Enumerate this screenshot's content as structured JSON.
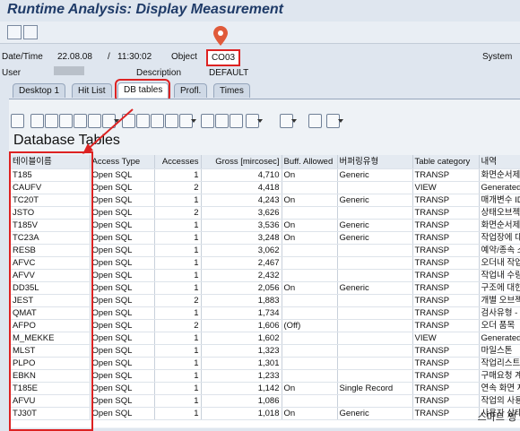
{
  "title": "Runtime Analysis: Display Measurement",
  "info": {
    "date_label": "Date/Time",
    "date": "22.08.08",
    "sep": "/",
    "time": "11:30:02",
    "object_label": "Object",
    "object_value": "CO03",
    "system_label": "System",
    "user_label": "User",
    "description_label": "Description",
    "description_value": "DEFAULT"
  },
  "tabs": [
    "Desktop 1",
    "Hit List",
    "DB tables",
    "Profl.",
    "Times"
  ],
  "heading": "Database Tables",
  "columns": [
    "테이블이름",
    "Access Type",
    "Accesses",
    "Gross [mircosec]",
    "Buff. Allowed",
    "버퍼링유형",
    "Table category",
    "내역"
  ],
  "rows": [
    [
      "T185",
      "Open SQL",
      "1",
      "4,710",
      "On",
      "Generic",
      "TRANSP",
      "화면순서제어"
    ],
    [
      "CAUFV",
      "Open SQL",
      "2",
      "4,418",
      "",
      "",
      "VIEW",
      "Generated T"
    ],
    [
      "TC20T",
      "Open SQL",
      "1",
      "4,243",
      "On",
      "Generic",
      "TRANSP",
      "매개변수 ID"
    ],
    [
      "JSTO",
      "Open SQL",
      "2",
      "3,626",
      "",
      "",
      "TRANSP",
      "상태오브젝트"
    ],
    [
      "T185V",
      "Open SQL",
      "1",
      "3,536",
      "On",
      "Generic",
      "TRANSP",
      "화면순서제어"
    ],
    [
      "TC23A",
      "Open SQL",
      "1",
      "3,248",
      "On",
      "Generic",
      "TRANSP",
      "작업장에 대한"
    ],
    [
      "RESB",
      "Open SQL",
      "1",
      "3,062",
      "",
      "",
      "TRANSP",
      "예약/종속 소"
    ],
    [
      "AFVC",
      "Open SQL",
      "1",
      "2,467",
      "",
      "",
      "TRANSP",
      "오더내 작업"
    ],
    [
      "AFVV",
      "Open SQL",
      "1",
      "2,432",
      "",
      "",
      "TRANSP",
      "작업내 수량/"
    ],
    [
      "DD35L",
      "Open SQL",
      "1",
      "2,056",
      "On",
      "Generic",
      "TRANSP",
      "구조에 대한"
    ],
    [
      "JEST",
      "Open SQL",
      "2",
      "1,883",
      "",
      "",
      "TRANSP",
      "개별 오브젝트"
    ],
    [
      "QMAT",
      "Open SQL",
      "1",
      "1,734",
      "",
      "",
      "TRANSP",
      "검사유형 - 자"
    ],
    [
      "AFPO",
      "Open SQL",
      "2",
      "1,606",
      "(Off)",
      "",
      "TRANSP",
      "오더 품목"
    ],
    [
      "M_MEKKE",
      "Open SQL",
      "1",
      "1,602",
      "",
      "",
      "VIEW",
      "Generated T"
    ],
    [
      "MLST",
      "Open SQL",
      "1",
      "1,323",
      "",
      "",
      "TRANSP",
      "마일스톤"
    ],
    [
      "PLPO",
      "Open SQL",
      "1",
      "1,301",
      "",
      "",
      "TRANSP",
      "작업리스트 -"
    ],
    [
      "EBKN",
      "Open SQL",
      "1",
      "1,233",
      "",
      "",
      "TRANSP",
      "구매요청 계정"
    ],
    [
      "T185E",
      "Open SQL",
      "1",
      "1,142",
      "On",
      "Single Record",
      "TRANSP",
      "연속 화면 제"
    ],
    [
      "AFVU",
      "Open SQL",
      "1",
      "1,086",
      "",
      "",
      "TRANSP",
      "작업의 사용자"
    ],
    [
      "TJ30T",
      "Open SQL",
      "1",
      "1,018",
      "On",
      "Generic",
      "TRANSP",
      "사용자 상태"
    ]
  ],
  "watermark": "스마트 쩡",
  "colors": {
    "highlight": "#d22222",
    "title": "#1f3b68"
  },
  "icons": [
    "save-icon",
    "new-session-icon",
    "detail-icon",
    "print-icon",
    "find-icon",
    "find-next-icon",
    "sort-asc-icon",
    "sort-desc-icon",
    "filter-icon",
    "sum-icon",
    "subtotal-icon",
    "export-icon",
    "layout-icon",
    "select-layout-icon",
    "save-layout-icon",
    "display-icon",
    "database-icon",
    "info-icon"
  ]
}
